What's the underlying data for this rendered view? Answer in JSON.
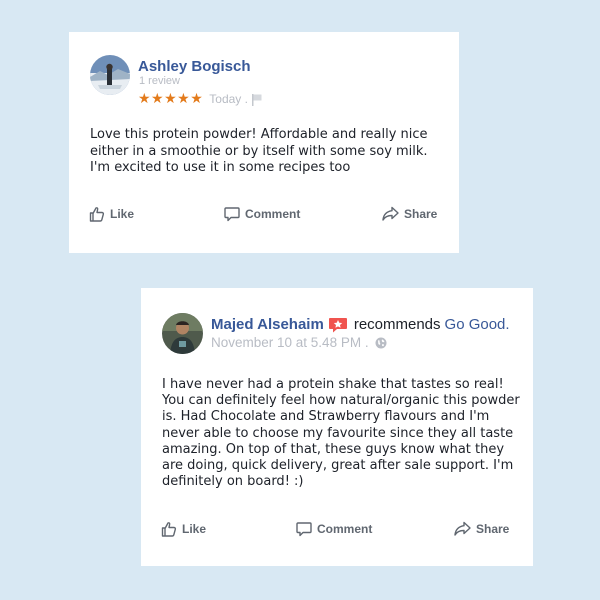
{
  "review": {
    "author": "Ashley Bogisch",
    "review_count": "1 review",
    "stars": "★★★★★",
    "date": "Today ."
  },
  "review_body": "Love this protein powder! Affordable and really nice either in a smoothie or by itself with some soy milk. I'm excited to use it in some recipes too",
  "recommendation": {
    "author": "Majed Alsehaim",
    "verb": "recommends",
    "page": "Go Good.",
    "date": "November 10 at 5.48 PM .",
    "body": "I have never had a protein shake that tastes so real! You can definitely feel how natural/organic this powder is. Had Chocolate and Strawberry flavours and I'm never able to choose my favourite since they all taste amazing. On top of that, these guys know what they are doing, quick delivery, great after sale support. I'm definitely on board! :)"
  },
  "actions": {
    "like": "Like",
    "comment": "Comment",
    "share": "Share"
  },
  "colors": {
    "background": "#d8e8f3",
    "name_link": "#385898",
    "stars": "#e37b1c",
    "meta_gray": "#b8bcc4",
    "action_gray": "#606770",
    "badge_red": "#f0544f"
  }
}
